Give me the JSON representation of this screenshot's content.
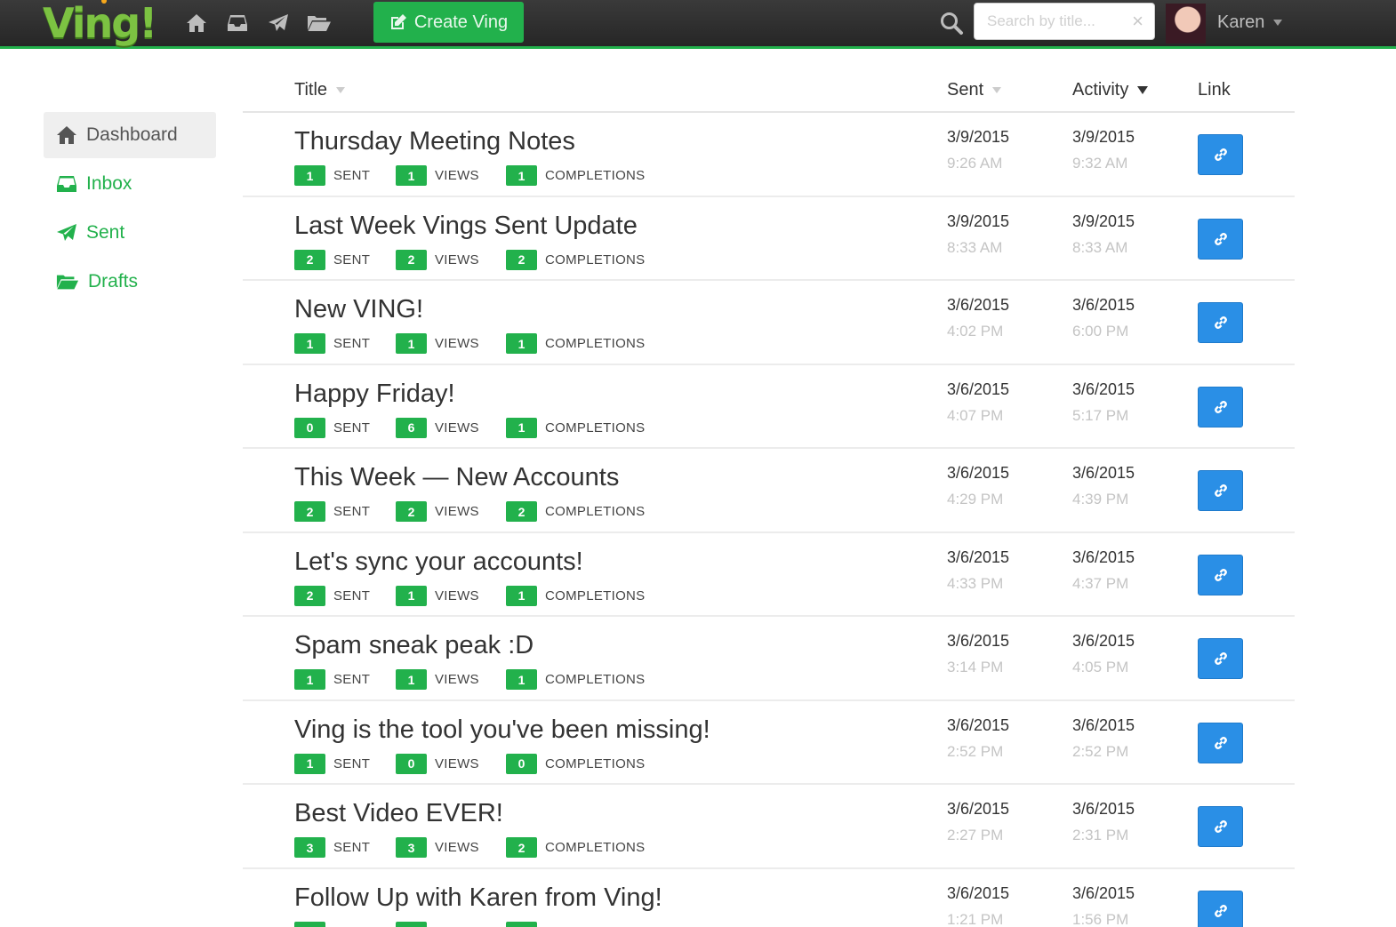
{
  "header": {
    "logo_text": "Ving!",
    "create_button_label": "Create Ving",
    "search_placeholder": "Search by title...",
    "search_clear": "×",
    "user_name": "Karen",
    "brand_color": "#22b14c",
    "nav_icons": [
      "home-icon",
      "inbox-icon",
      "paper-plane-icon",
      "folder-open-icon"
    ]
  },
  "sidebar": {
    "items": [
      {
        "label": "Dashboard",
        "icon": "home-icon",
        "active": true
      },
      {
        "label": "Inbox",
        "icon": "inbox-icon",
        "active": false
      },
      {
        "label": "Sent",
        "icon": "paper-plane-icon",
        "active": false
      },
      {
        "label": "Drafts",
        "icon": "folder-open-icon",
        "active": false
      }
    ]
  },
  "table": {
    "columns": {
      "title": "Title",
      "sent": "Sent",
      "activity": "Activity",
      "link": "Link"
    },
    "stat_labels": {
      "sent": "SENT",
      "views": "VIEWS",
      "completions": "COMPLETIONS"
    },
    "rows": [
      {
        "title": "Thursday Meeting Notes",
        "sent": "1",
        "views": "1",
        "completions": "1",
        "sent_date": "3/9/2015",
        "sent_time": "9:26 AM",
        "activity_date": "3/9/2015",
        "activity_time": "9:32 AM"
      },
      {
        "title": "Last Week Vings Sent Update",
        "sent": "2",
        "views": "2",
        "completions": "2",
        "sent_date": "3/9/2015",
        "sent_time": "8:33 AM",
        "activity_date": "3/9/2015",
        "activity_time": "8:33 AM"
      },
      {
        "title": "New VING!",
        "sent": "1",
        "views": "1",
        "completions": "1",
        "sent_date": "3/6/2015",
        "sent_time": "4:02 PM",
        "activity_date": "3/6/2015",
        "activity_time": "6:00 PM"
      },
      {
        "title": "Happy Friday!",
        "sent": "0",
        "views": "6",
        "completions": "1",
        "sent_date": "3/6/2015",
        "sent_time": "4:07 PM",
        "activity_date": "3/6/2015",
        "activity_time": "5:17 PM"
      },
      {
        "title": "This Week — New Accounts",
        "sent": "2",
        "views": "2",
        "completions": "2",
        "sent_date": "3/6/2015",
        "sent_time": "4:29 PM",
        "activity_date": "3/6/2015",
        "activity_time": "4:39 PM"
      },
      {
        "title": "Let's sync your accounts!",
        "sent": "2",
        "views": "1",
        "completions": "1",
        "sent_date": "3/6/2015",
        "sent_time": "4:33 PM",
        "activity_date": "3/6/2015",
        "activity_time": "4:37 PM"
      },
      {
        "title": "Spam sneak peak :D",
        "sent": "1",
        "views": "1",
        "completions": "1",
        "sent_date": "3/6/2015",
        "sent_time": "3:14 PM",
        "activity_date": "3/6/2015",
        "activity_time": "4:05 PM"
      },
      {
        "title": "Ving is the tool you've been missing!",
        "sent": "1",
        "views": "0",
        "completions": "0",
        "sent_date": "3/6/2015",
        "sent_time": "2:52 PM",
        "activity_date": "3/6/2015",
        "activity_time": "2:52 PM"
      },
      {
        "title": "Best Video EVER!",
        "sent": "3",
        "views": "3",
        "completions": "2",
        "sent_date": "3/6/2015",
        "sent_time": "2:27 PM",
        "activity_date": "3/6/2015",
        "activity_time": "2:31 PM"
      },
      {
        "title": "Follow Up with Karen from Ving!",
        "sent": "",
        "views": "",
        "completions": "",
        "sent_date": "3/6/2015",
        "sent_time": "1:21 PM",
        "activity_date": "3/6/2015",
        "activity_time": "1:56 PM"
      }
    ]
  }
}
